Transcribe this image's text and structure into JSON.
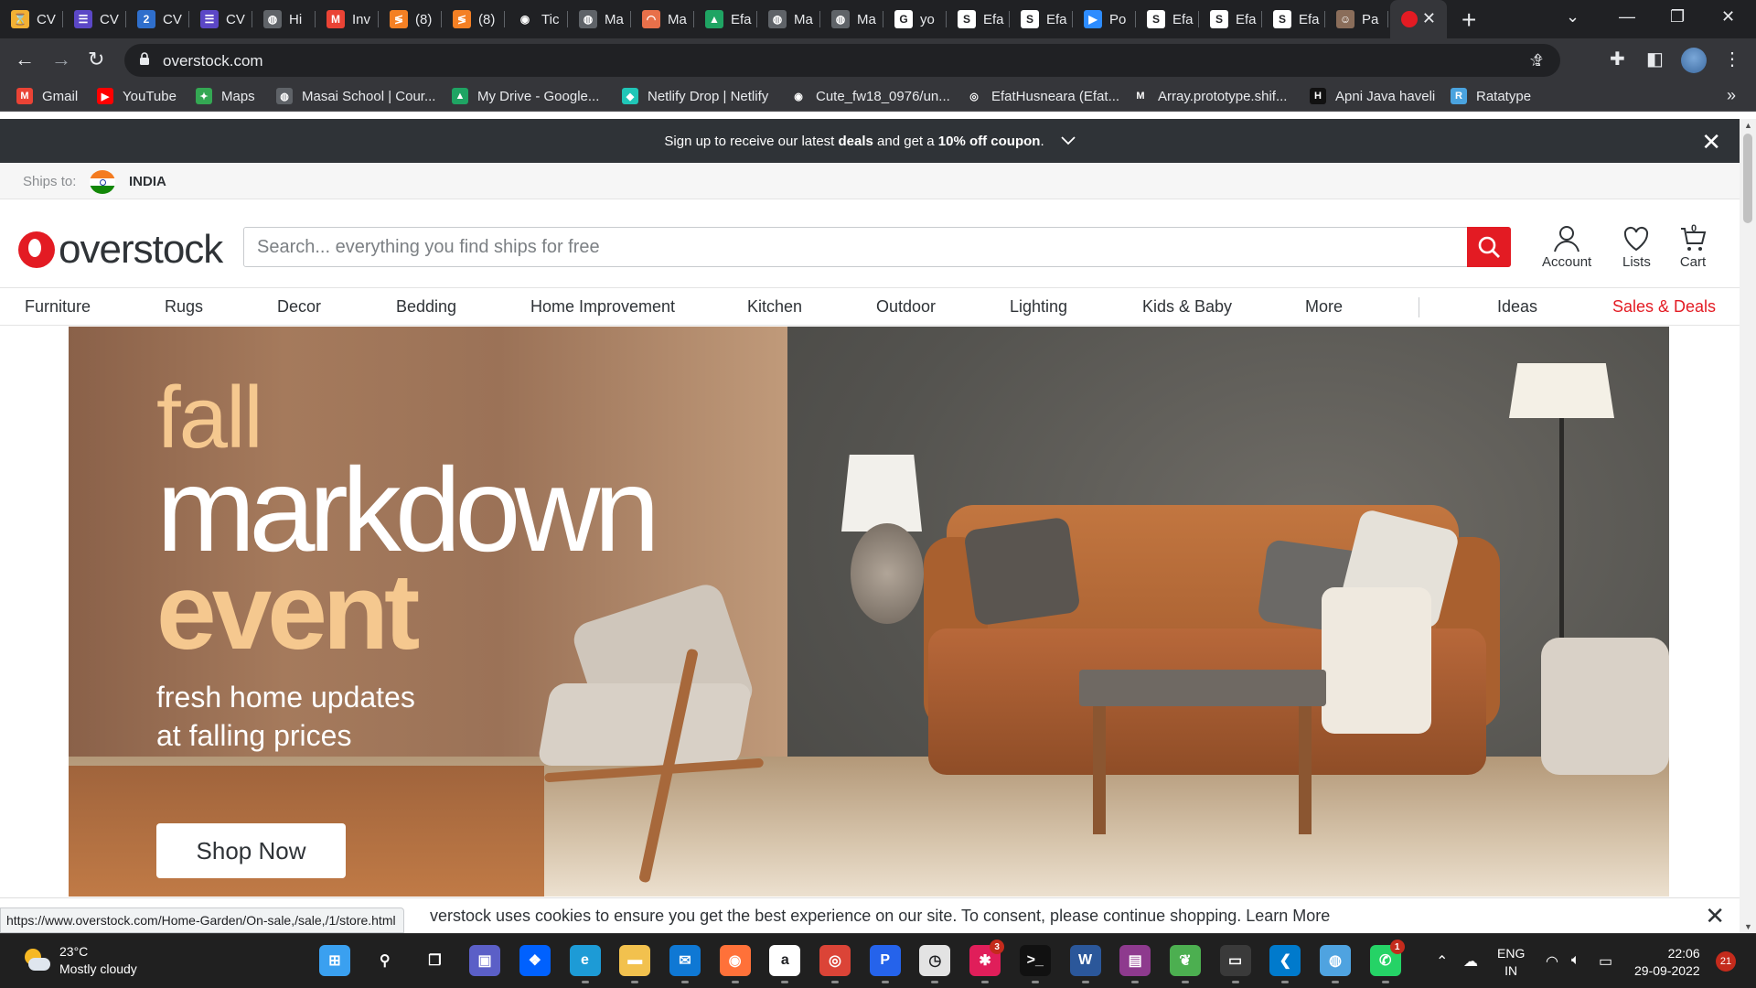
{
  "browser": {
    "tabs": [
      {
        "label": "CV",
        "icon": "hourglass-icon",
        "color": "#f2b134",
        "glyph": "⌛"
      },
      {
        "label": "CV",
        "icon": "form-icon",
        "color": "#5b47c6",
        "glyph": "☰"
      },
      {
        "label": "CV",
        "icon": "two-icon",
        "color": "#2f6fcc",
        "glyph": "2"
      },
      {
        "label": "CV",
        "icon": "form-icon",
        "color": "#5b47c6",
        "glyph": "☰"
      },
      {
        "label": "Hi",
        "icon": "globe-icon",
        "color": "#5f6368",
        "glyph": "◍"
      },
      {
        "label": "Inv",
        "icon": "gmail-icon",
        "color": "#ea4335",
        "glyph": "M"
      },
      {
        "label": "(8)",
        "icon": "stack-icon",
        "color": "#f48024",
        "glyph": "≶"
      },
      {
        "label": "(8)",
        "icon": "stack-icon",
        "color": "#f48024",
        "glyph": "≶"
      },
      {
        "label": "Tic",
        "icon": "github-icon",
        "color": "#202124",
        "glyph": "◉"
      },
      {
        "label": "Ma",
        "icon": "globe-icon",
        "color": "#5f6368",
        "glyph": "◍"
      },
      {
        "label": "Ma",
        "icon": "masai-icon",
        "color": "#e8704a",
        "glyph": "◠"
      },
      {
        "label": "Efa",
        "icon": "drive-icon",
        "color": "#1fa463",
        "glyph": "▲"
      },
      {
        "label": "Ma",
        "icon": "globe-icon",
        "color": "#5f6368",
        "glyph": "◍"
      },
      {
        "label": "Ma",
        "icon": "globe-icon",
        "color": "#5f6368",
        "glyph": "◍"
      },
      {
        "label": "yo",
        "icon": "google-icon",
        "color": "#ffffff",
        "glyph": "G"
      },
      {
        "label": "Efa",
        "icon": "stack-s-icon",
        "color": "#ffffff",
        "glyph": "S"
      },
      {
        "label": "Efa",
        "icon": "stack-s-icon",
        "color": "#ffffff",
        "glyph": "S"
      },
      {
        "label": "Po",
        "icon": "zoom-icon",
        "color": "#2d8cff",
        "glyph": "▶"
      },
      {
        "label": "Efa",
        "icon": "stack-s-icon",
        "color": "#ffffff",
        "glyph": "S"
      },
      {
        "label": "Efa",
        "icon": "stack-s-icon",
        "color": "#ffffff",
        "glyph": "S"
      },
      {
        "label": "Efa",
        "icon": "stack-s-icon",
        "color": "#ffffff",
        "glyph": "S"
      },
      {
        "label": "Pa",
        "icon": "avatar-icon",
        "color": "#8a6d5a",
        "glyph": "☺"
      }
    ],
    "active_tab_icon": "overstock-icon",
    "url": "overstock.com",
    "bookmarks": [
      {
        "label": "Gmail",
        "icon": "gmail-icon",
        "color": "#ea4335",
        "glyph": "M"
      },
      {
        "label": "YouTube",
        "icon": "youtube-icon",
        "color": "#ff0000",
        "glyph": "▶"
      },
      {
        "label": "Maps",
        "icon": "maps-icon",
        "color": "#34a853",
        "glyph": "✦"
      },
      {
        "label": "Masai School | Cour...",
        "icon": "globe-icon",
        "color": "#5f6368",
        "glyph": "◍"
      },
      {
        "label": "My Drive - Google...",
        "icon": "drive-icon",
        "color": "#1fa463",
        "glyph": "▲"
      },
      {
        "label": "Netlify Drop | Netlify",
        "icon": "netlify-icon",
        "color": "#20c6b7",
        "glyph": "◆"
      },
      {
        "label": "Cute_fw18_0976/un...",
        "icon": "github-icon",
        "color": "#35363a",
        "glyph": "◉"
      },
      {
        "label": "EfatHusneara (Efat...",
        "icon": "codepen-icon",
        "color": "#35363a",
        "glyph": "◎"
      },
      {
        "label": "Array.prototype.shif...",
        "icon": "mdn-icon",
        "color": "#35363a",
        "glyph": "M"
      },
      {
        "label": "Apni Java haveli",
        "icon": "haveli-icon",
        "color": "#111111",
        "glyph": "H"
      },
      {
        "label": "Ratatype",
        "icon": "ratatype-icon",
        "color": "#4aa3df",
        "glyph": "R"
      }
    ]
  },
  "site": {
    "promo": {
      "pre": "Sign up to receive our latest ",
      "deals": "deals",
      "mid": " and get a ",
      "coupon": "10% off coupon",
      "post": "."
    },
    "ships_to_label": "Ships to:",
    "country": "INDIA",
    "logo_text": "overstock",
    "search_placeholder": "Search... everything you find ships for free",
    "account_label": "Account",
    "lists_label": "Lists",
    "cart_label": "Cart",
    "cart_count": "0",
    "categories": [
      "Furniture",
      "Rugs",
      "Decor",
      "Bedding",
      "Home Improvement",
      "Kitchen",
      "Outdoor",
      "Lighting",
      "Kids & Baby",
      "More"
    ],
    "ideas_label": "Ideas",
    "deals_label": "Sales & Deals",
    "brand_red": "#e31b23",
    "hero": {
      "line1": "fall",
      "line2": "markdown",
      "line3": "event",
      "sub1": "fresh home updates",
      "sub2": "at falling prices",
      "cta": "Shop Now",
      "accent": "#f5c88f"
    },
    "cookie_text": "verstock uses cookies to ensure you get the best experience on our site. To consent, please continue shopping.",
    "cookie_link": "Learn More",
    "status_url": "https://www.overstock.com/Home-Garden/On-sale,/sale,/1/store.html"
  },
  "taskbar": {
    "temp": "23°C",
    "weather": "Mostly cloudy",
    "apps": [
      {
        "name": "windows-start-icon",
        "color": "#3aa0f0",
        "glyph": "⊞"
      },
      {
        "name": "search-icon",
        "color": "transparent",
        "glyph": "⚲"
      },
      {
        "name": "task-view-icon",
        "color": "transparent",
        "glyph": "❐"
      },
      {
        "name": "teams-chat-icon",
        "color": "#5b5fc7",
        "glyph": "▣"
      },
      {
        "name": "dropbox-icon",
        "color": "#0061fe",
        "glyph": "❖"
      },
      {
        "name": "edge-icon",
        "color": "#1d9bd6",
        "glyph": "e"
      },
      {
        "name": "file-explorer-icon",
        "color": "#f2c14e",
        "glyph": "▬"
      },
      {
        "name": "mail-icon",
        "color": "#0f78d4",
        "glyph": "✉"
      },
      {
        "name": "firefox-icon",
        "color": "#ff7139",
        "glyph": "◉"
      },
      {
        "name": "amazon-icon",
        "color": "#ffffff",
        "glyph": "a"
      },
      {
        "name": "chrome-icon",
        "color": "#db4437",
        "glyph": "◎"
      },
      {
        "name": "app-p-icon",
        "color": "#2563eb",
        "glyph": "P"
      },
      {
        "name": "wpm-icon",
        "color": "#e3e3e3",
        "glyph": "◷"
      },
      {
        "name": "slack-icon",
        "color": "#e01e5a",
        "glyph": "✱",
        "badge": "3"
      },
      {
        "name": "terminal-icon",
        "color": "#111111",
        "glyph": ">_"
      },
      {
        "name": "word-icon",
        "color": "#2b579a",
        "glyph": "W"
      },
      {
        "name": "winrar-icon",
        "color": "#8e3a8e",
        "glyph": "▤"
      },
      {
        "name": "leaf-app-icon",
        "color": "#4caf50",
        "glyph": "❦"
      },
      {
        "name": "mysql-icon",
        "color": "#3a3a3a",
        "glyph": "▭"
      },
      {
        "name": "vscode-icon",
        "color": "#007acc",
        "glyph": "❮"
      },
      {
        "name": "globe-app-icon",
        "color": "#4fa3e0",
        "glyph": "◍"
      },
      {
        "name": "whatsapp-icon",
        "color": "#25d366",
        "glyph": "✆",
        "badge": "1"
      }
    ],
    "lang1": "ENG",
    "lang2": "IN",
    "time": "22:06",
    "date": "29-09-2022",
    "notifications": "21"
  }
}
